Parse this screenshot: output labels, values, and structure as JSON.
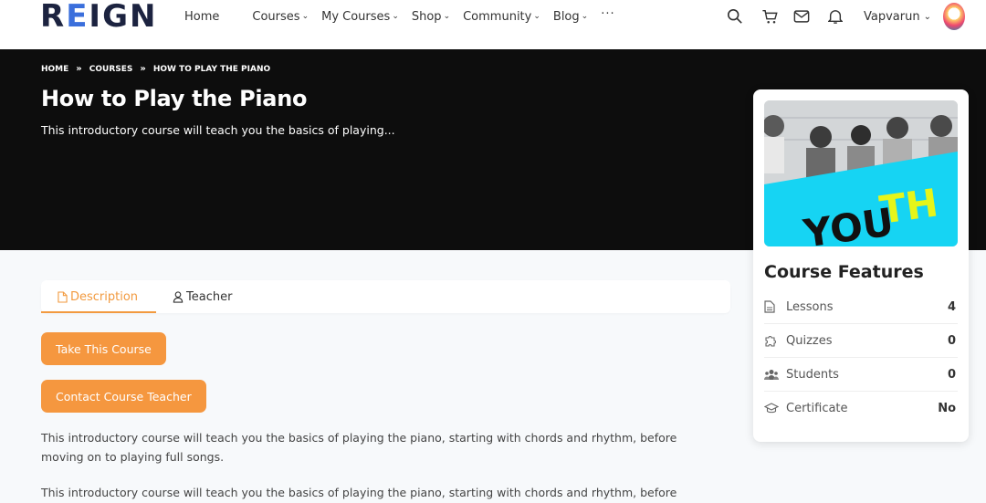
{
  "brand": {
    "name_prefix": "R",
    "name_e": "E",
    "name_suffix": "IGN"
  },
  "nav": {
    "home": "Home",
    "courses": "Courses",
    "my_courses": "My Courses",
    "shop": "Shop",
    "community": "Community",
    "blog": "Blog",
    "more": "···"
  },
  "user": {
    "name": "Vapvarun"
  },
  "breadcrumb": {
    "home": "HOME",
    "courses": "COURSES",
    "current": "HOW TO PLAY THE PIANO"
  },
  "course": {
    "title": "How to Play the Piano",
    "subtitle": "This introductory course will teach you the basics of playing..."
  },
  "tabs": {
    "description": "Description",
    "teacher": "Teacher"
  },
  "buttons": {
    "take": "Take This Course",
    "contact": "Contact Course Teacher"
  },
  "content": {
    "para1": "This introductory course will teach you the basics of playing the piano, starting with chords and rhythm, before moving on to playing full songs.",
    "para2": "This introductory course will teach you the basics of playing the piano, starting with chords and rhythm, before"
  },
  "features": {
    "title": "Course Features",
    "thumb_text_a": "YOU",
    "thumb_text_b": "TH",
    "lessons_label": "Lessons",
    "lessons_value": "4",
    "quizzes_label": "Quizzes",
    "quizzes_value": "0",
    "students_label": "Students",
    "students_value": "0",
    "certificate_label": "Certificate",
    "certificate_value": "No"
  },
  "colors": {
    "accent": "#f5973f",
    "hero_bg": "#0d0d0d",
    "brand_dark": "#1c2340",
    "brand_blue": "#3b6fdc"
  }
}
